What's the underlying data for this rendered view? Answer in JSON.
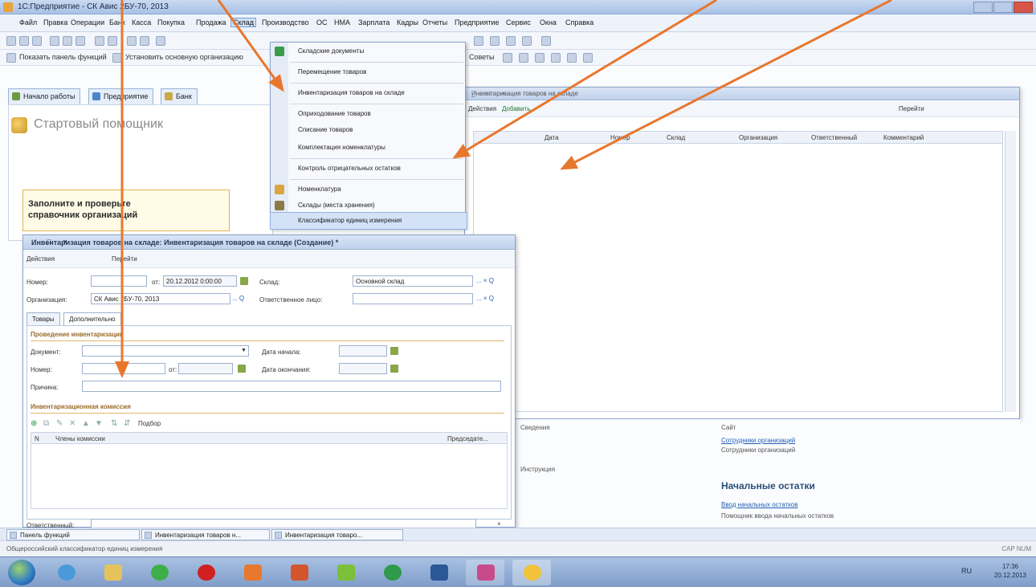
{
  "window": {
    "title": "1С:Предприятие - СК Авис 2БУ-70, 2013"
  },
  "menubar": {
    "items": [
      "Файл",
      "Правка",
      "Операции",
      "Банк",
      "Касса",
      "Покупка",
      "Продажа",
      "Склад",
      "Производство",
      "ОС",
      "НМА",
      "Зарплата",
      "Кадры",
      "Отчеты",
      "Предприятие",
      "Сервис",
      "Окна",
      "Справка"
    ],
    "active": "Склад"
  },
  "toolbar2": {
    "show_panel": "Показать панель функций",
    "set_org": "Установить основную организацию",
    "tips": "Советы"
  },
  "tabs": [
    "Начало работы",
    "Предприятие",
    "Банк"
  ],
  "start": {
    "title": "Стартовый помощник",
    "box_text": "Заполните и проверьте\nсправочник организаций"
  },
  "dropdown": {
    "items": [
      "Складские документы",
      "Перемещение товаров",
      "Инвентаризация товаров на складе",
      "Оприходование товаров",
      "Списание товаров",
      "Комплектация номенклатуры",
      "Контроль отрицательных остатков",
      "Номенклатура",
      "Склады (места хранения)",
      "Классификатор единиц измерения"
    ]
  },
  "inv_list": {
    "title": "Инвентаризация товаров на складе",
    "actions": "Действия",
    "add": "Добавить",
    "goto": "Перейти",
    "columns": [
      "Дата",
      "Номер",
      "Склад",
      "Организация",
      "Ответственный",
      "Комментарий"
    ]
  },
  "inv_doc": {
    "title": "Инвентаризация товаров на складе: Инвентаризация товаров на складе (Создание) *",
    "actions": "Действия",
    "goto": "Перейти",
    "number_label": "Номер:",
    "from_label": "от:",
    "date_value": "20.12.2012 0:00:00",
    "warehouse_label": "Склад:",
    "warehouse_value": "Основной склад",
    "org_label": "Организация:",
    "org_value": "СК Авис 2БУ-70, 2013",
    "responsible_label": "Ответственное лицо:",
    "tabs": [
      "Товары",
      "Дополнительно"
    ],
    "section1": "Проведение инвентаризации",
    "doc_label": "Документ:",
    "start_date_label": "Дата начала:",
    "end_date_label": "Дата окончания:",
    "number2_label": "Номер:",
    "from2_label": "от:",
    "reason_label": "Причина:",
    "section2": "Инвентаризационная комиссия",
    "pick_label": "Подбор",
    "col_n": "N",
    "col_member": "Члены комиссии",
    "col_chair": "Председате...",
    "responsible2_label": "Ответственный:"
  },
  "bottom_right": {
    "staff_text": "Сотрудники организаций",
    "staff_link": "Сотрудники организаций",
    "opening_head": "Начальные остатки",
    "opening_link": "Ввод начальных остатков",
    "opening_sub": "Помощник ввода начальных остатков",
    "mid1": "Сведения",
    "mid2": "Инструкция",
    "top_right": "Сайт"
  },
  "taskwin": [
    "Панель функций",
    "Инвентаризация товаров н...",
    "Инвентаризация товаро..."
  ],
  "status": {
    "text": "Общероссийский классификатор единиц измерения",
    "caps": "CAP NUM"
  },
  "tray": {
    "lang": "RU",
    "time": "17:36",
    "date": "20.12.2013"
  },
  "colors": {
    "arrow": "#e8772e",
    "accent": "#2b5797"
  }
}
